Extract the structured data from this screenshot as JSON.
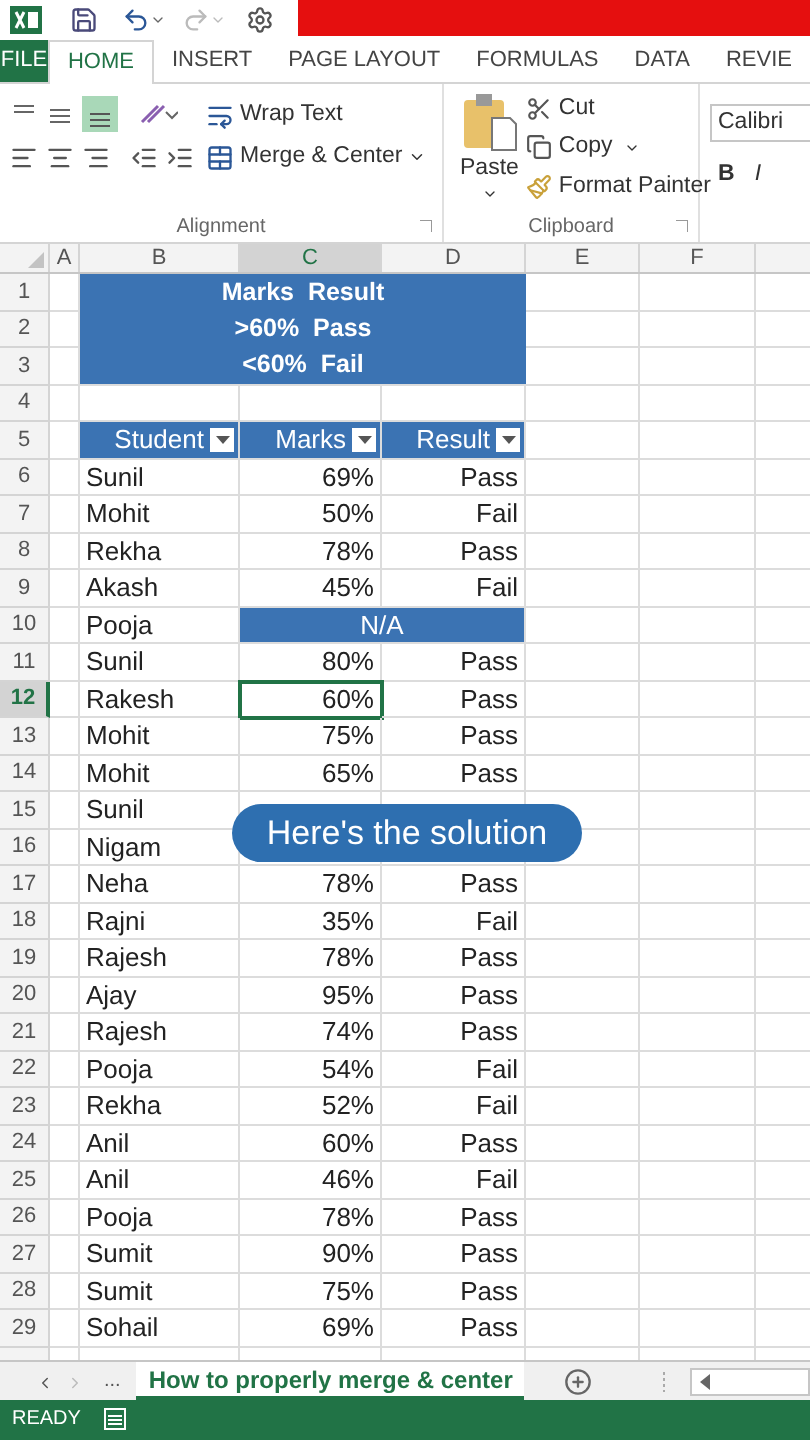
{
  "tabs": [
    {
      "label": "FILE",
      "kind": "file",
      "selected": false
    },
    {
      "label": "HOME",
      "kind": "tab",
      "selected": true
    },
    {
      "label": "INSERT",
      "kind": "tab",
      "selected": false
    },
    {
      "label": "PAGE LAYOUT",
      "kind": "tab",
      "selected": false
    },
    {
      "label": "FORMULAS",
      "kind": "tab",
      "selected": false
    },
    {
      "label": "DATA",
      "kind": "tab",
      "selected": false
    },
    {
      "label": "REVIE",
      "kind": "tab",
      "selected": false
    }
  ],
  "ribbon": {
    "alignment": {
      "wrap_text": "Wrap Text",
      "merge_center": "Merge & Center",
      "label": "Alignment"
    },
    "clipboard": {
      "paste": "Paste",
      "cut": "Cut",
      "copy": "Copy",
      "format_painter": "Format Painter",
      "label": "Clipboard"
    },
    "font": {
      "name": "Calibri",
      "styles": [
        "B",
        "I"
      ]
    }
  },
  "columns": [
    {
      "label": "A",
      "selected": false
    },
    {
      "label": "B",
      "selected": false
    },
    {
      "label": "C",
      "selected": true
    },
    {
      "label": "D",
      "selected": false
    },
    {
      "label": "E",
      "selected": false
    },
    {
      "label": "F",
      "selected": false
    }
  ],
  "rows": [
    {
      "number": "1",
      "kind": "title",
      "selected": false,
      "cells": [
        "Marks  Result"
      ]
    },
    {
      "number": "2",
      "kind": "title",
      "selected": false,
      "cells": [
        ">60%  Pass"
      ]
    },
    {
      "number": "3",
      "kind": "title",
      "selected": false,
      "cells": [
        "<60%  Fail"
      ]
    },
    {
      "number": "4",
      "kind": "empty",
      "selected": false,
      "cells": []
    },
    {
      "number": "5",
      "kind": "header",
      "selected": false,
      "cells": [
        "Student",
        "Marks",
        "Result"
      ]
    },
    {
      "number": "6",
      "kind": "data",
      "selected": false,
      "cells": [
        "Sunil",
        "69%",
        "Pass"
      ]
    },
    {
      "number": "7",
      "kind": "data",
      "selected": false,
      "cells": [
        "Mohit",
        "50%",
        "Fail"
      ]
    },
    {
      "number": "8",
      "kind": "data",
      "selected": false,
      "cells": [
        "Rekha",
        "78%",
        "Pass"
      ]
    },
    {
      "number": "9",
      "kind": "data",
      "selected": false,
      "cells": [
        "Akash",
        "45%",
        "Fail"
      ]
    },
    {
      "number": "10",
      "kind": "merged",
      "selected": false,
      "cells": [
        "Pooja",
        "N/A"
      ]
    },
    {
      "number": "11",
      "kind": "data",
      "selected": false,
      "cells": [
        "Sunil",
        "80%",
        "Pass"
      ]
    },
    {
      "number": "12",
      "kind": "data",
      "selected": true,
      "cells": [
        "Rakesh",
        "60%",
        "Pass"
      ]
    },
    {
      "number": "13",
      "kind": "data",
      "selected": false,
      "cells": [
        "Mohit",
        "75%",
        "Pass"
      ]
    },
    {
      "number": "14",
      "kind": "data",
      "selected": false,
      "cells": [
        "Mohit",
        "65%",
        "Pass"
      ]
    },
    {
      "number": "15",
      "kind": "data",
      "selected": false,
      "cells": [
        "Sunil"
      ]
    },
    {
      "number": "16",
      "kind": "data",
      "selected": false,
      "cells": [
        "Nigam"
      ]
    },
    {
      "number": "17",
      "kind": "data",
      "selected": false,
      "cells": [
        "Neha",
        "78%",
        "Pass"
      ]
    },
    {
      "number": "18",
      "kind": "data",
      "selected": false,
      "cells": [
        "Rajni",
        "35%",
        "Fail"
      ]
    },
    {
      "number": "19",
      "kind": "data",
      "selected": false,
      "cells": [
        "Rajesh",
        "78%",
        "Pass"
      ]
    },
    {
      "number": "20",
      "kind": "data",
      "selected": false,
      "cells": [
        "Ajay",
        "95%",
        "Pass"
      ]
    },
    {
      "number": "21",
      "kind": "data",
      "selected": false,
      "cells": [
        "Rajesh",
        "74%",
        "Pass"
      ]
    },
    {
      "number": "22",
      "kind": "data",
      "selected": false,
      "cells": [
        "Pooja",
        "54%",
        "Fail"
      ]
    },
    {
      "number": "23",
      "kind": "data",
      "selected": false,
      "cells": [
        "Rekha",
        "52%",
        "Fail"
      ]
    },
    {
      "number": "24",
      "kind": "data",
      "selected": false,
      "cells": [
        "Anil",
        "60%",
        "Pass"
      ]
    },
    {
      "number": "25",
      "kind": "data",
      "selected": false,
      "cells": [
        "Anil",
        "46%",
        "Fail"
      ]
    },
    {
      "number": "26",
      "kind": "data",
      "selected": false,
      "cells": [
        "Pooja",
        "78%",
        "Pass"
      ]
    },
    {
      "number": "27",
      "kind": "data",
      "selected": false,
      "cells": [
        "Sumit",
        "90%",
        "Pass"
      ]
    },
    {
      "number": "28",
      "kind": "data",
      "selected": false,
      "cells": [
        "Sumit",
        "75%",
        "Pass"
      ]
    },
    {
      "number": "29",
      "kind": "data",
      "selected": false,
      "cells": [
        "Sohail",
        "69%",
        "Pass"
      ]
    }
  ],
  "caption": "Here's the solution",
  "sheet_tabs": {
    "ellipsis": "...",
    "tabs": [
      {
        "label": "How to properly merge & center",
        "selected": true
      }
    ]
  },
  "status_bar": {
    "text": "READY"
  }
}
